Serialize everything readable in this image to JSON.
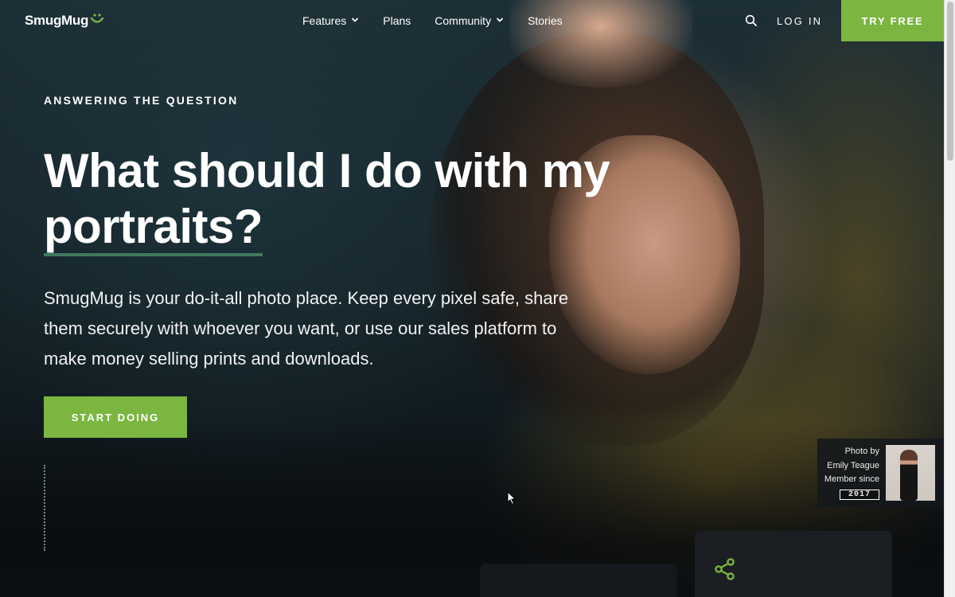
{
  "header": {
    "logo_text": "SmugMug",
    "nav": [
      {
        "label": "Features",
        "has_dropdown": true
      },
      {
        "label": "Plans",
        "has_dropdown": false
      },
      {
        "label": "Community",
        "has_dropdown": true
      },
      {
        "label": "Stories",
        "has_dropdown": false
      }
    ],
    "search_icon": "search-icon",
    "login_label": "LOG IN",
    "try_free_label": "TRY FREE"
  },
  "hero": {
    "eyebrow": "ANSWERING THE QUESTION",
    "headline_line1": "What should I do with my",
    "headline_line2": "portraits?",
    "subtext": "SmugMug is your do-it-all photo place. Keep every pixel safe, share them securely with whoever you want, or use our sales platform to make money selling prints and downloads.",
    "cta_label": "START DOING"
  },
  "photo_credit": {
    "line1": "Photo by",
    "line2": "Emily Teague",
    "line3": "Member since",
    "year": "2017"
  },
  "colors": {
    "accent_green": "#7ab640",
    "underline_green": "#3f7a5f"
  },
  "icons": {
    "share": "share-icon"
  }
}
